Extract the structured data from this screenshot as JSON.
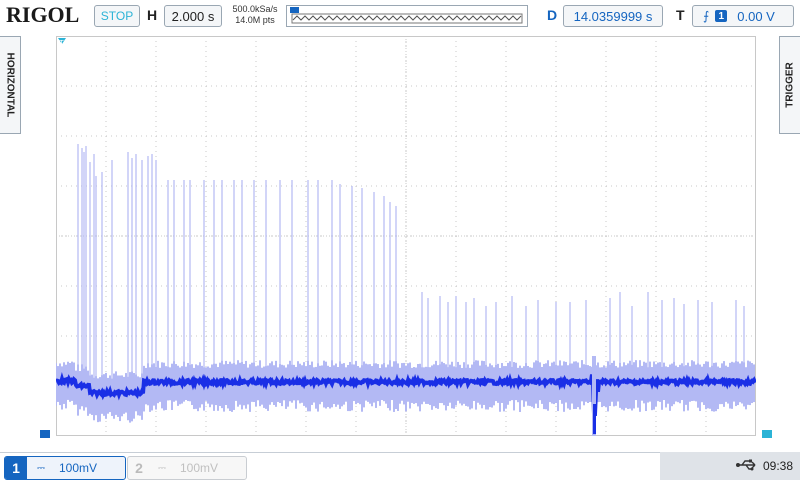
{
  "header": {
    "logo": "RIGOL",
    "run_status": "STOP",
    "h_label": "H",
    "timebase": "2.000 s",
    "sample_rate": "500.0kSa/s",
    "memory_depth": "14.0M pts",
    "d_label": "D",
    "delay": "14.0359999 s",
    "t_label": "T",
    "trigger_channel": "1",
    "trigger_level": "0.00 V"
  },
  "side": {
    "left_label": "HORIZONTAL",
    "right_label": "TRIGGER"
  },
  "channels": {
    "ch1": {
      "number": "1",
      "coupling": "⎓",
      "scale": "100mV"
    },
    "ch2": {
      "number": "2",
      "coupling": "⎓",
      "scale": "100mV"
    }
  },
  "status": {
    "time": "09:38"
  },
  "colors": {
    "trace": "#1a2fe6",
    "trace_light": "#b3b9f4",
    "grid": "#c8c8c8",
    "accent": "#1565c0"
  },
  "icons": {
    "usb": "usb-icon",
    "trigger_edge": "rising-edge-icon"
  }
}
